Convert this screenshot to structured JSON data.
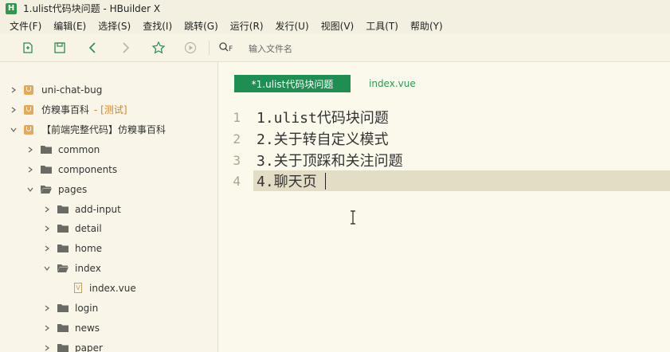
{
  "window": {
    "title": "1.ulist代码块问题 - HBuilder X",
    "logo_letter": "H"
  },
  "menu": [
    "文件(F)",
    "编辑(E)",
    "选择(S)",
    "查找(I)",
    "跳转(G)",
    "运行(R)",
    "发行(U)",
    "视图(V)",
    "工具(T)",
    "帮助(Y)"
  ],
  "toolbar": {
    "search_hint": "F",
    "file_search_placeholder": "输入文件名"
  },
  "tree": {
    "project1": "uni-chat-bug",
    "project2": "仿糗事百科",
    "project2_tag": "- [测试]",
    "project3": "【前端完整代码】仿糗事百科",
    "folders": {
      "common": "common",
      "components": "components",
      "pages": "pages",
      "add_input": "add-input",
      "detail": "detail",
      "home": "home",
      "index": "index",
      "login": "login",
      "news": "news",
      "paper": "paper"
    },
    "file_index_vue": "index.vue"
  },
  "editor": {
    "tabs": [
      {
        "label": "*1.ulist代码块问题"
      },
      {
        "label": "index.vue"
      }
    ],
    "lines": [
      {
        "no": "1",
        "text": "1.ulist代码块问题"
      },
      {
        "no": "2",
        "text": "2.关于转自定义模式"
      },
      {
        "no": "3",
        "text": "3.关于顶踩和关注问题"
      },
      {
        "no": "4",
        "text": "4.聊天页"
      }
    ]
  },
  "colors": {
    "accent": "#1e8e52",
    "background": "#fbf8ec",
    "active_line": "#e4ddc5",
    "tag": "#d4861f"
  }
}
